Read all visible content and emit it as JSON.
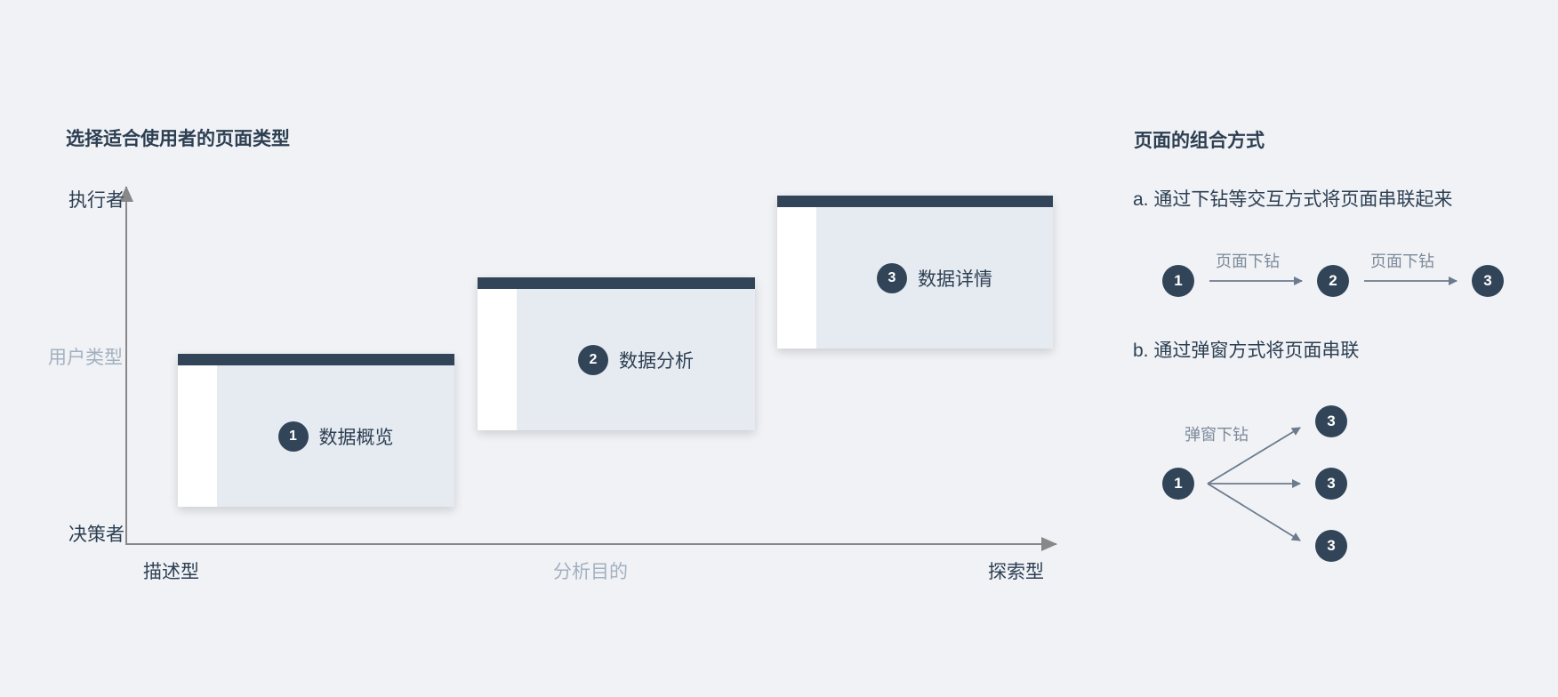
{
  "left": {
    "title": "选择适合使用者的页面类型",
    "y_axis": {
      "top": "执行者",
      "middle": "用户类型",
      "bottom": "决策者"
    },
    "x_axis": {
      "left": "描述型",
      "middle": "分析目的",
      "right": "探索型"
    },
    "cards": [
      {
        "num": "1",
        "label": "数据概览"
      },
      {
        "num": "2",
        "label": "数据分析"
      },
      {
        "num": "3",
        "label": "数据详情"
      }
    ]
  },
  "right": {
    "title": "页面的组合方式",
    "a": {
      "heading": "a. 通过下钻等交互方式将页面串联起来",
      "nodes": [
        "1",
        "2",
        "3"
      ],
      "edge_label_1": "页面下钻",
      "edge_label_2": "页面下钻"
    },
    "b": {
      "heading": "b. 通过弹窗方式将页面串联",
      "source": "1",
      "targets": [
        "3",
        "3",
        "3"
      ],
      "edge_label": "弹窗下钻"
    }
  },
  "colors": {
    "dark": "#324558",
    "card": "#e6ebf2",
    "background": "#f0f2f6",
    "arrow": "#6b7b8d"
  }
}
